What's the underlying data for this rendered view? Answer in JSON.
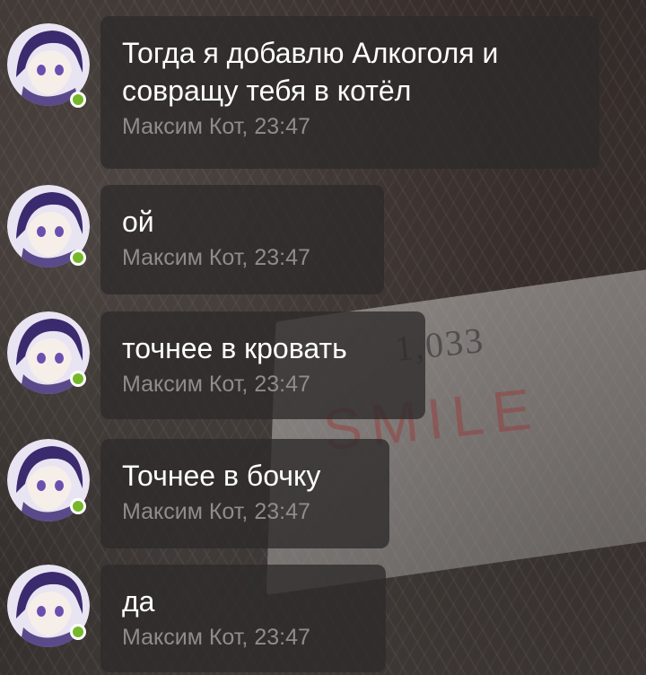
{
  "messages": [
    {
      "text": "Тогда я добавлю Алкоголя и\nсовращу тебя в котёл",
      "author": "Максим Кот",
      "time": "23:47"
    },
    {
      "text": "ой",
      "author": "Максим Кот",
      "time": "23:47"
    },
    {
      "text": "точнее в кровать",
      "author": "Максим Кот",
      "time": "23:47"
    },
    {
      "text": "Точнее в бочку",
      "author": "Максим Кот",
      "time": "23:47"
    },
    {
      "text": "да",
      "author": "Максим Кот",
      "time": "23:47"
    }
  ],
  "meta_lines": [
    "Максим Кот, 23:47",
    "Максим Кот, 23:47",
    "Максим Кот, 23:47",
    "Максим Кот, 23:47",
    "Максим Кот, 23:47"
  ],
  "background": {
    "book_title": "1,033",
    "book_word": "SMILE"
  },
  "colors": {
    "online_dot": "#76b82a",
    "bubble_bg": "rgba(45,42,42,0.78)",
    "meta_text": "#8f8c8c"
  },
  "icons": {
    "avatar": "anime-avatar-icon",
    "online": "online-status-dot"
  }
}
